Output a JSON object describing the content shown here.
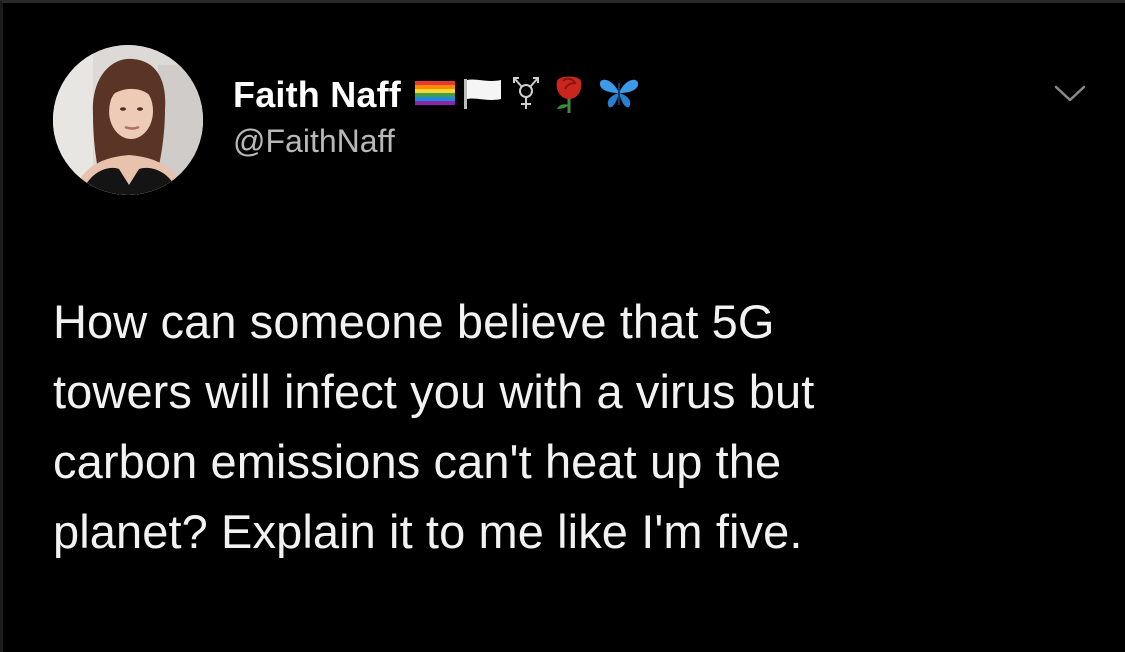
{
  "tweet": {
    "author": {
      "display_name": "Faith Naff",
      "handle": "@FaithNaff",
      "avatar_icon": "profile-photo-icon",
      "name_badges": [
        "rainbow-flag-icon",
        "white-flag-icon",
        "transgender-symbol-icon",
        "rose-icon",
        "butterfly-icon"
      ]
    },
    "menu_icon": "chevron-down-icon",
    "text_lines": [
      "How can someone believe that 5G",
      "towers will infect you with a virus but",
      "carbon emissions can't heat up the",
      "planet? Explain it to me like I'm five."
    ]
  },
  "colors": {
    "background": "#000000",
    "text_primary": "#ffffff",
    "text_secondary": "#b8b8b8",
    "butterfly": "#3b9be8",
    "rose": "#c8261f"
  }
}
